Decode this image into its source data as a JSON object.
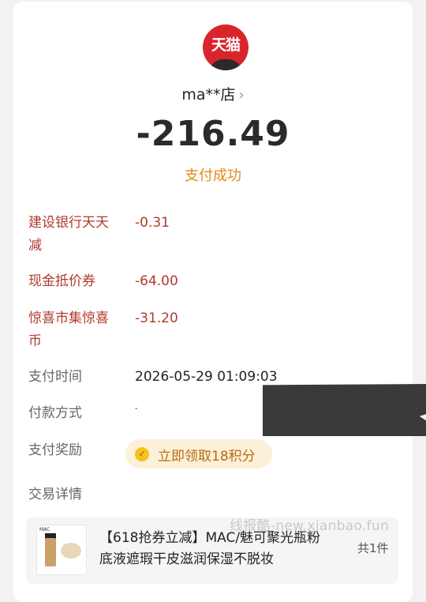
{
  "shop": {
    "logo_text": "天猫",
    "name": "ma**店",
    "chevron": "›"
  },
  "payment": {
    "amount": "-216.49",
    "status": "支付成功"
  },
  "discounts": [
    {
      "label": "建设银行天天减",
      "value": "-0.31"
    },
    {
      "label": "现金抵价券",
      "value": "-64.00"
    },
    {
      "label": "惊喜市集惊喜币",
      "value": "-31.20"
    }
  ],
  "details": {
    "pay_time_label": "支付时间",
    "pay_time_value": "2026-05-29 01:09:03",
    "pay_method_label": "付款方式",
    "pay_method_value": "-",
    "reward_label": "支付奖励",
    "reward_button": "立即领取18积分",
    "reward_icon": "coin-icon",
    "trade_label": "交易详情"
  },
  "product": {
    "brand": "MAC",
    "title": "【618抢券立减】MAC/魅可聚光瓶粉底液遮瑕干皮滋润保湿不脱妆",
    "count": "共1件"
  },
  "watermark": "线报酷-new.xianbao.fun",
  "colors": {
    "accent_orange": "#e28a1a",
    "discount_red": "#b03a2e",
    "logo_red": "#d8252c"
  }
}
